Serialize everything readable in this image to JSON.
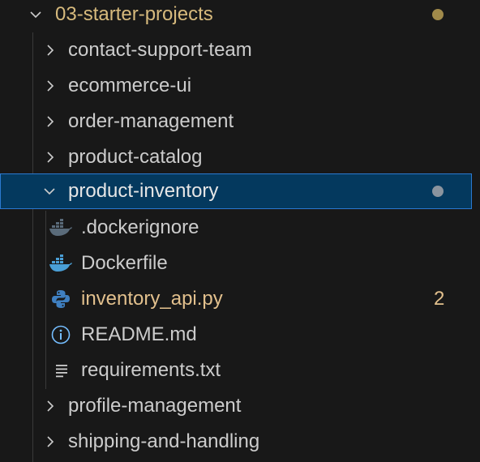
{
  "explorer": {
    "root_folder": {
      "label": "03-starter-projects",
      "label_color": "#d7ba7d",
      "decoration": "modified-dot",
      "dot_color": "#a08a4a"
    },
    "folders": [
      {
        "label": "contact-support-team",
        "expanded": false,
        "icon": "chevron-right-icon"
      },
      {
        "label": "ecommerce-ui",
        "expanded": false,
        "icon": "chevron-right-icon"
      },
      {
        "label": "order-management",
        "expanded": false,
        "icon": "chevron-right-icon"
      },
      {
        "label": "product-catalog",
        "expanded": false,
        "icon": "chevron-right-icon"
      }
    ],
    "selected_folder": {
      "label": "product-inventory",
      "expanded": true,
      "selected": true,
      "decoration": "dot",
      "dot_color": "#8b949e"
    },
    "files": [
      {
        "label": ".dockerignore",
        "icon": "docker-icon",
        "icon_color": "#5a6b7a"
      },
      {
        "label": "Dockerfile",
        "icon": "docker-icon",
        "icon_color": "#4a9fd6"
      },
      {
        "label": "inventory_api.py",
        "icon": "python-icon",
        "icon_color": "#3f7fc0",
        "label_color": "#e2c08d",
        "problems_count": "2"
      },
      {
        "label": "README.md",
        "icon": "info-icon",
        "icon_color": "#75beff"
      },
      {
        "label": "requirements.txt",
        "icon": "lines-icon",
        "icon_color": "#cccccc"
      }
    ],
    "folders_after": [
      {
        "label": "profile-management",
        "expanded": false,
        "icon": "chevron-right-icon"
      },
      {
        "label": "shipping-and-handling",
        "expanded": false,
        "icon": "chevron-right-icon"
      }
    ]
  }
}
